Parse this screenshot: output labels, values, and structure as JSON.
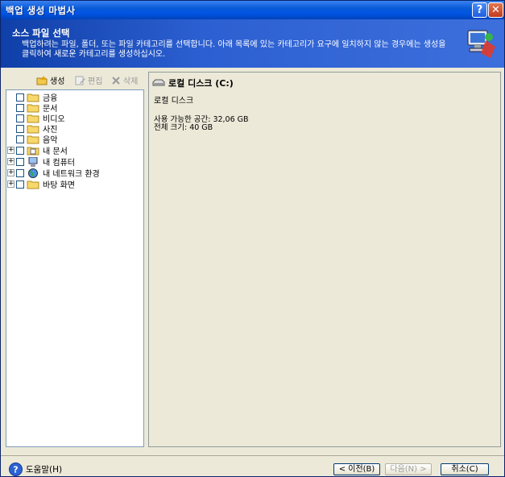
{
  "window": {
    "title": "백업 생성 마법사"
  },
  "header": {
    "title": "소스 파일 선택",
    "description": "백업하려는 파일, 폴더, 또는 파일 카테고리를 선택합니다. 아래 목록에 있는 카테고리가 요구에 일치하지 않는 경우에는 생성을 클릭하여 새로운 카테고리를 생성하십시오."
  },
  "toolbar": {
    "create": "생성",
    "edit": "편집",
    "delete": "삭제"
  },
  "tree": {
    "items": [
      {
        "label": "금융"
      },
      {
        "label": "문서"
      },
      {
        "label": "비디오"
      },
      {
        "label": "사진"
      },
      {
        "label": "음악"
      },
      {
        "label": "내 문서"
      },
      {
        "label": "내 컴퓨터"
      },
      {
        "label": "내 네트워크 환경"
      },
      {
        "label": "바탕 화면"
      }
    ]
  },
  "details": {
    "title": "로컬 디스크 (C:)",
    "subtitle": "로컬 디스크",
    "free_space": "사용 가능한 공간: 32,06 GB",
    "total_size": "전체 크기: 40 GB"
  },
  "footer": {
    "help": "도움말(H)",
    "back": "< 이전(B)",
    "next": "다음(N) >",
    "cancel": "취소(C)"
  }
}
